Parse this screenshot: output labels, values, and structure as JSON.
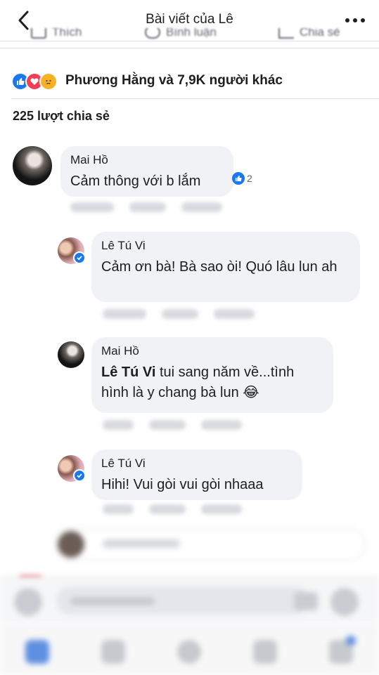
{
  "header": {
    "title": "Bài viết của Lê"
  },
  "action_bar": {
    "like_label": "Thích",
    "comment_label": "Bình luận",
    "share_label": "Chia sẻ"
  },
  "reactions": {
    "icons": [
      "like-icon",
      "love-icon",
      "sad-icon"
    ],
    "summary": "Phương Hằng và 7,9K người khác"
  },
  "shares": {
    "text": "225 lượt chia sẻ"
  },
  "comments": [
    {
      "author": "Mai Hồ",
      "text": "Cảm thông với b lắm",
      "like_count": "2",
      "replies": [
        {
          "author": "Lê Tú Vi",
          "text": "Cảm ơn bà! Bà sao òi! Quó lâu lun ah"
        },
        {
          "author": "Mai Hồ",
          "tag": "Lê Tú Vi",
          "text": " tui sang năm về...tình hình là y chang bà lun 😂"
        },
        {
          "author": "Lê Tú Vi",
          "text": "Hihi! Vui gòi vui gòi nhaaa"
        }
      ]
    }
  ],
  "colors": {
    "accent": "#1877f2",
    "bubble": "#f0f2f5",
    "text": "#1c1e21",
    "muted": "#606770"
  }
}
